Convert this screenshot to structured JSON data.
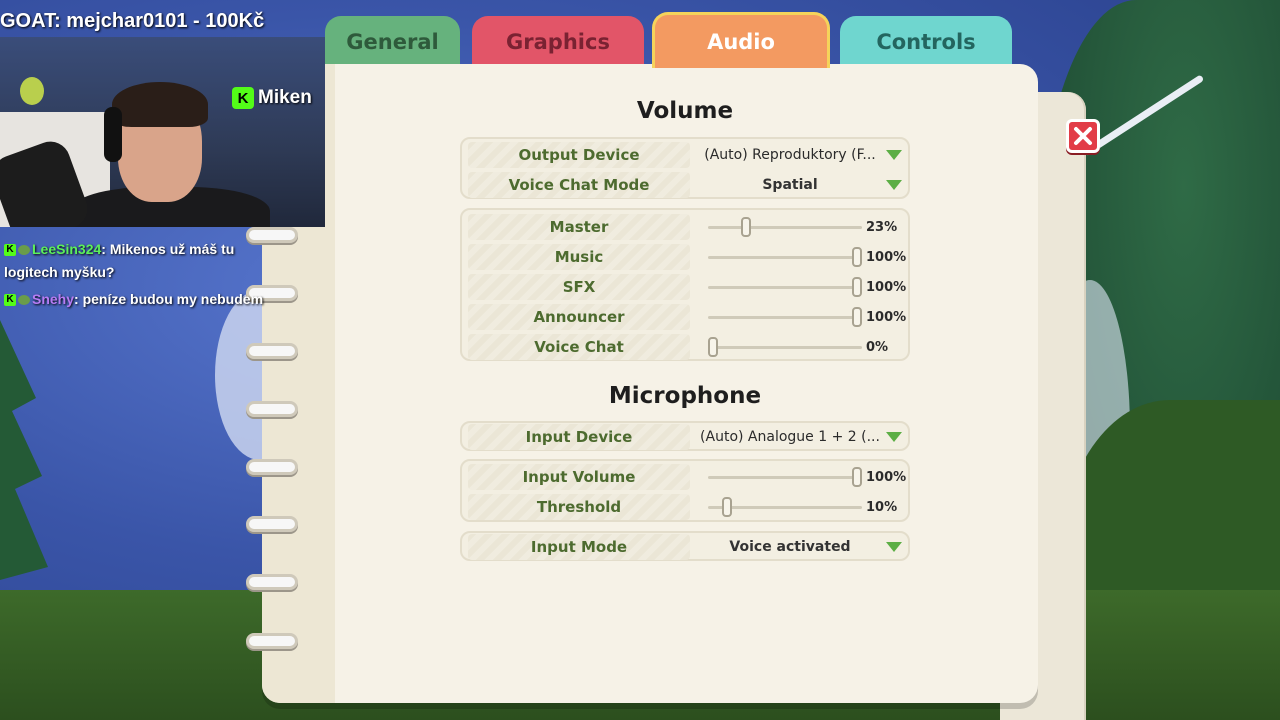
{
  "tabs": {
    "general": "General",
    "graphics": "Graphics",
    "audio": "Audio",
    "controls": "Controls"
  },
  "volume": {
    "title": "Volume",
    "output_device": {
      "label": "Output Device",
      "value": "(Auto) Reproduktory (F..."
    },
    "voice_chat_mode": {
      "label": "Voice Chat Mode",
      "value": "Spatial"
    },
    "sliders": [
      {
        "label": "Master",
        "value": 0.23,
        "display": "23%"
      },
      {
        "label": "Music",
        "value": 1.0,
        "display": "100%"
      },
      {
        "label": "SFX",
        "value": 1.0,
        "display": "100%"
      },
      {
        "label": "Announcer",
        "value": 1.0,
        "display": "100%"
      },
      {
        "label": "Voice Chat",
        "value": 0.0,
        "display": "0%"
      }
    ]
  },
  "microphone": {
    "title": "Microphone",
    "input_device": {
      "label": "Input Device",
      "value": "(Auto) Analogue 1 + 2 (..."
    },
    "sliders": [
      {
        "label": "Input Volume",
        "value": 1.0,
        "display": "100%"
      },
      {
        "label": "Threshold",
        "value": 0.1,
        "display": "10%"
      }
    ],
    "input_mode": {
      "label": "Input Mode",
      "value": "Voice activated"
    }
  },
  "overlay": {
    "goat": "GOAT: mejchar0101 - 100Kč",
    "kick_name": "Miken",
    "chat": [
      {
        "user": "LeeSin324",
        "message": ": Mikenos už máš tu logitech myšku?"
      },
      {
        "user": "Snehy",
        "message": ": peníze budou my nebudem"
      }
    ]
  },
  "colors": {
    "accent_green": "#5cae45",
    "label_green": "#4d6b2f",
    "close_red": "#e23c47",
    "tab_audio": "#f39a61"
  }
}
